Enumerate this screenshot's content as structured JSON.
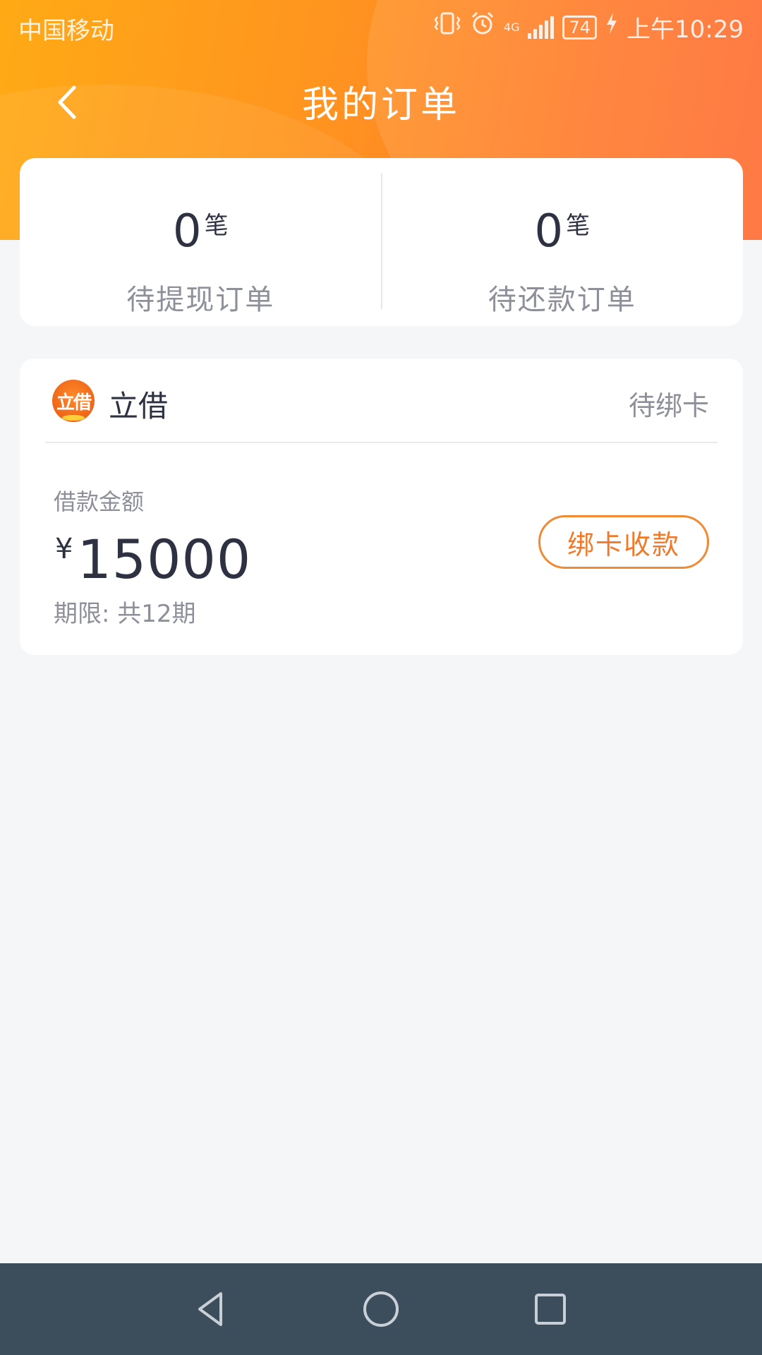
{
  "status_bar": {
    "carrier": "中国移动",
    "network": "4G",
    "battery": "74",
    "time": "上午10:29"
  },
  "header": {
    "title": "我的订单",
    "back_icon": "chevron-left-icon"
  },
  "summary": {
    "pending_withdraw": {
      "count": "0",
      "unit": "笔",
      "label": "待提现订单"
    },
    "pending_repay": {
      "count": "0",
      "unit": "笔",
      "label": "待还款订单"
    }
  },
  "order": {
    "logo_text": "立借",
    "brand": "立借",
    "status": "待绑卡",
    "amount_label": "借款金额",
    "currency": "¥",
    "amount": "15000",
    "term": "期限: 共12期",
    "action_label": "绑卡收款"
  },
  "colors": {
    "accent": "#ff9220",
    "button_border": "#f08a35",
    "text_primary": "#2d3142",
    "text_secondary": "#8d8f99",
    "nav_bar": "#3c4d5c"
  },
  "system_nav": {
    "back_icon": "triangle-back-icon",
    "home_icon": "circle-home-icon",
    "recents_icon": "square-recents-icon"
  }
}
